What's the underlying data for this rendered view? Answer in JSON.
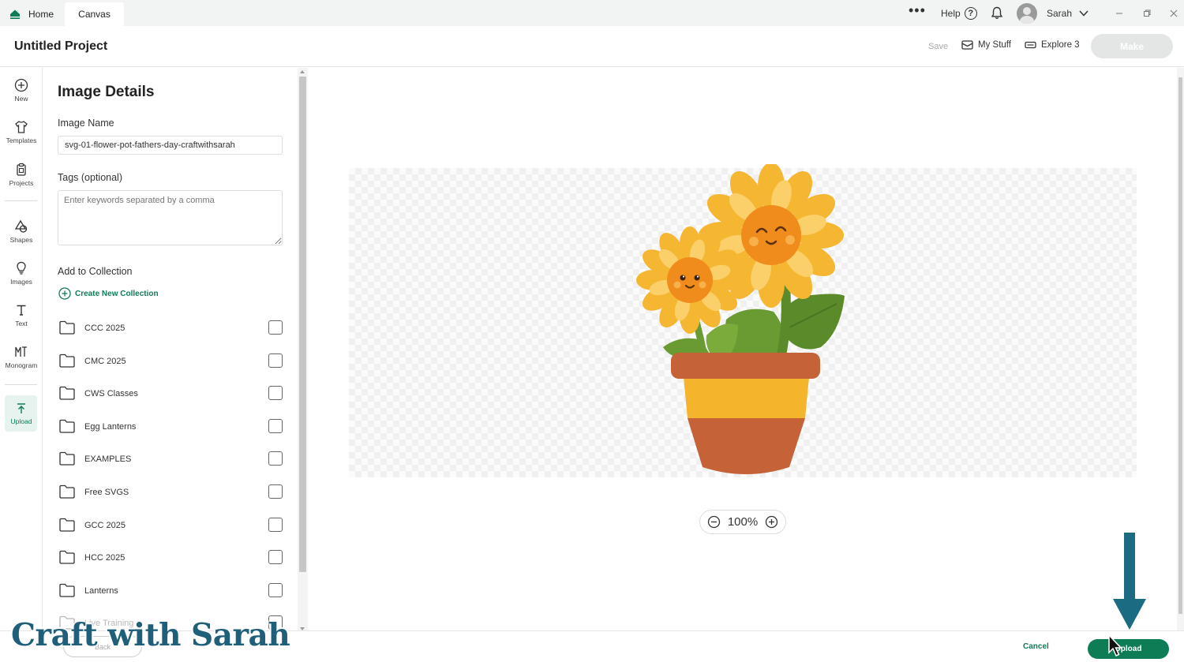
{
  "tabs": {
    "home": "Home",
    "canvas": "Canvas"
  },
  "topbar": {
    "help": "Help",
    "help_glyph": "?",
    "user_name": "Sarah"
  },
  "header": {
    "title": "Untitled Project",
    "save": "Save",
    "my_stuff": "My Stuff",
    "machine": "Explore 3",
    "make": "Make"
  },
  "rail": {
    "new": "New",
    "templates": "Templates",
    "projects": "Projects",
    "shapes": "Shapes",
    "images": "Images",
    "text": "Text",
    "monogram": "Monogram",
    "upload": "Upload"
  },
  "panel": {
    "title": "Image Details",
    "image_name_label": "Image Name",
    "image_name_value": "svg-01-flower-pot-fathers-day-craftwithsarah",
    "tags_label": "Tags (optional)",
    "tags_placeholder": "Enter keywords separated by a comma",
    "collection_label": "Add to Collection",
    "create_collection": "Create New Collection",
    "collections": [
      "CCC 2025",
      "CMC 2025",
      "CWS Classes",
      "Egg Lanterns",
      "EXAMPLES",
      "Free SVGS",
      "GCC 2025",
      "HCC 2025",
      "Lanterns",
      "Live Training"
    ]
  },
  "zoom": {
    "level": "100%"
  },
  "bottom": {
    "back": "Back",
    "cancel": "Cancel",
    "upload": "Upload"
  },
  "watermark": "Craft with Sarah",
  "colors": {
    "accent": "#0e7c55",
    "watermark": "#1f5f79",
    "arrow": "#1b6b83"
  }
}
